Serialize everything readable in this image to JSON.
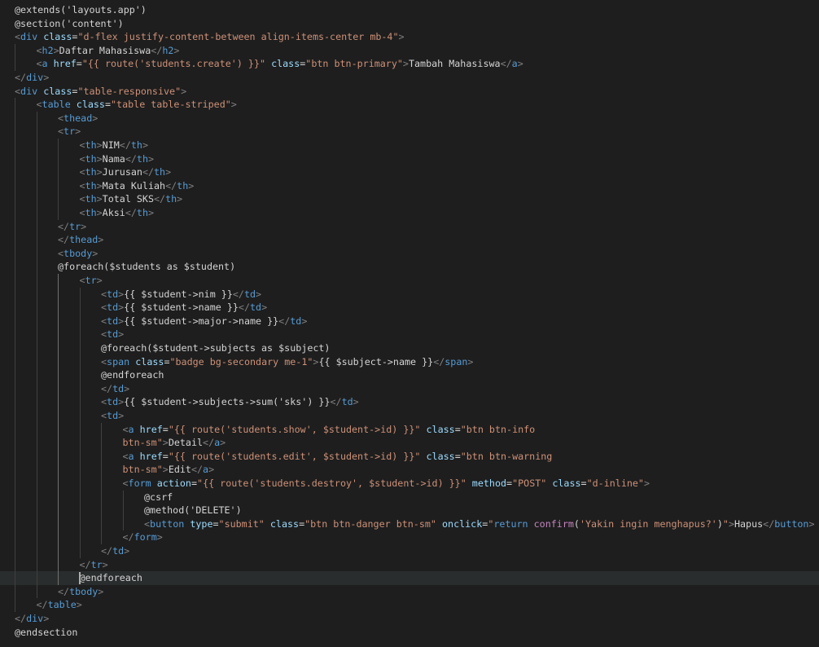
{
  "editor": {
    "language": "blade",
    "theme_colors": {
      "background": "#1e1e1e",
      "current_line": "#2a2d2e",
      "tag": "#569cd6",
      "attribute": "#9cdcfe",
      "string": "#ce9178",
      "directive": "#c586c0",
      "text": "#d4d4d4",
      "punctuation": "#808080"
    },
    "current_line_index": 42,
    "lines": [
      {
        "indent": 0,
        "segs": [
          [
            "text",
            "@extends('layouts.app')"
          ]
        ]
      },
      {
        "indent": 0,
        "segs": [
          [
            "text",
            "@section('content')"
          ]
        ]
      },
      {
        "indent": 0,
        "segs": [
          [
            "punct",
            "<"
          ],
          [
            "tag",
            "div"
          ],
          [
            "text",
            " "
          ],
          [
            "attr",
            "class"
          ],
          [
            "text",
            "="
          ],
          [
            "str",
            "\"d-flex justify-content-between align-items-center mb-4\""
          ],
          [
            "punct",
            ">"
          ]
        ]
      },
      {
        "indent": 1,
        "segs": [
          [
            "punct",
            "<"
          ],
          [
            "tag",
            "h2"
          ],
          [
            "punct",
            ">"
          ],
          [
            "text",
            "Daftar Mahasiswa"
          ],
          [
            "punct",
            "</"
          ],
          [
            "tag",
            "h2"
          ],
          [
            "punct",
            ">"
          ]
        ]
      },
      {
        "indent": 1,
        "segs": [
          [
            "punct",
            "<"
          ],
          [
            "tag",
            "a"
          ],
          [
            "text",
            " "
          ],
          [
            "attr",
            "href"
          ],
          [
            "text",
            "="
          ],
          [
            "str",
            "\"{{ route('students.create') }}\""
          ],
          [
            "text",
            " "
          ],
          [
            "attr",
            "class"
          ],
          [
            "text",
            "="
          ],
          [
            "str",
            "\"btn btn-primary\""
          ],
          [
            "punct",
            ">"
          ],
          [
            "text",
            "Tambah Mahasiswa"
          ],
          [
            "punct",
            "</"
          ],
          [
            "tag",
            "a"
          ],
          [
            "punct",
            ">"
          ]
        ]
      },
      {
        "indent": 0,
        "segs": [
          [
            "punct",
            "</"
          ],
          [
            "tag",
            "div"
          ],
          [
            "punct",
            ">"
          ]
        ]
      },
      {
        "indent": 0,
        "segs": [
          [
            "punct",
            "<"
          ],
          [
            "tag",
            "div"
          ],
          [
            "text",
            " "
          ],
          [
            "attr",
            "class"
          ],
          [
            "text",
            "="
          ],
          [
            "str",
            "\"table-responsive\""
          ],
          [
            "punct",
            ">"
          ]
        ]
      },
      {
        "indent": 1,
        "segs": [
          [
            "punct",
            "<"
          ],
          [
            "tag",
            "table"
          ],
          [
            "text",
            " "
          ],
          [
            "attr",
            "class"
          ],
          [
            "text",
            "="
          ],
          [
            "str",
            "\"table table-striped\""
          ],
          [
            "punct",
            ">"
          ]
        ]
      },
      {
        "indent": 2,
        "segs": [
          [
            "punct",
            "<"
          ],
          [
            "tag",
            "thead"
          ],
          [
            "punct",
            ">"
          ]
        ]
      },
      {
        "indent": 2,
        "segs": [
          [
            "punct",
            "<"
          ],
          [
            "tag",
            "tr"
          ],
          [
            "punct",
            ">"
          ]
        ]
      },
      {
        "indent": 3,
        "segs": [
          [
            "punct",
            "<"
          ],
          [
            "tag",
            "th"
          ],
          [
            "punct",
            ">"
          ],
          [
            "text",
            "NIM"
          ],
          [
            "punct",
            "</"
          ],
          [
            "tag",
            "th"
          ],
          [
            "punct",
            ">"
          ]
        ]
      },
      {
        "indent": 3,
        "segs": [
          [
            "punct",
            "<"
          ],
          [
            "tag",
            "th"
          ],
          [
            "punct",
            ">"
          ],
          [
            "text",
            "Nama"
          ],
          [
            "punct",
            "</"
          ],
          [
            "tag",
            "th"
          ],
          [
            "punct",
            ">"
          ]
        ]
      },
      {
        "indent": 3,
        "segs": [
          [
            "punct",
            "<"
          ],
          [
            "tag",
            "th"
          ],
          [
            "punct",
            ">"
          ],
          [
            "text",
            "Jurusan"
          ],
          [
            "punct",
            "</"
          ],
          [
            "tag",
            "th"
          ],
          [
            "punct",
            ">"
          ]
        ]
      },
      {
        "indent": 3,
        "segs": [
          [
            "punct",
            "<"
          ],
          [
            "tag",
            "th"
          ],
          [
            "punct",
            ">"
          ],
          [
            "text",
            "Mata Kuliah"
          ],
          [
            "punct",
            "</"
          ],
          [
            "tag",
            "th"
          ],
          [
            "punct",
            ">"
          ]
        ]
      },
      {
        "indent": 3,
        "segs": [
          [
            "punct",
            "<"
          ],
          [
            "tag",
            "th"
          ],
          [
            "punct",
            ">"
          ],
          [
            "text",
            "Total SKS"
          ],
          [
            "punct",
            "</"
          ],
          [
            "tag",
            "th"
          ],
          [
            "punct",
            ">"
          ]
        ]
      },
      {
        "indent": 3,
        "segs": [
          [
            "punct",
            "<"
          ],
          [
            "tag",
            "th"
          ],
          [
            "punct",
            ">"
          ],
          [
            "text",
            "Aksi"
          ],
          [
            "punct",
            "</"
          ],
          [
            "tag",
            "th"
          ],
          [
            "punct",
            ">"
          ]
        ]
      },
      {
        "indent": 2,
        "segs": [
          [
            "punct",
            "</"
          ],
          [
            "tag",
            "tr"
          ],
          [
            "punct",
            ">"
          ]
        ]
      },
      {
        "indent": 2,
        "segs": [
          [
            "punct",
            "</"
          ],
          [
            "tag",
            "thead"
          ],
          [
            "punct",
            ">"
          ]
        ]
      },
      {
        "indent": 2,
        "segs": [
          [
            "punct",
            "<"
          ],
          [
            "tag",
            "tbody"
          ],
          [
            "punct",
            ">"
          ]
        ]
      },
      {
        "indent": 2,
        "segs": [
          [
            "text",
            "@foreach($students as $student)"
          ]
        ]
      },
      {
        "indent": 3,
        "segs": [
          [
            "punct",
            "<"
          ],
          [
            "tag",
            "tr"
          ],
          [
            "punct",
            ">"
          ]
        ]
      },
      {
        "indent": 4,
        "segs": [
          [
            "punct",
            "<"
          ],
          [
            "tag",
            "td"
          ],
          [
            "punct",
            ">"
          ],
          [
            "text",
            "{{ $student->nim }}"
          ],
          [
            "punct",
            "</"
          ],
          [
            "tag",
            "td"
          ],
          [
            "punct",
            ">"
          ]
        ]
      },
      {
        "indent": 4,
        "segs": [
          [
            "punct",
            "<"
          ],
          [
            "tag",
            "td"
          ],
          [
            "punct",
            ">"
          ],
          [
            "text",
            "{{ $student->name }}"
          ],
          [
            "punct",
            "</"
          ],
          [
            "tag",
            "td"
          ],
          [
            "punct",
            ">"
          ]
        ]
      },
      {
        "indent": 4,
        "segs": [
          [
            "punct",
            "<"
          ],
          [
            "tag",
            "td"
          ],
          [
            "punct",
            ">"
          ],
          [
            "text",
            "{{ $student->major->name }}"
          ],
          [
            "punct",
            "</"
          ],
          [
            "tag",
            "td"
          ],
          [
            "punct",
            ">"
          ]
        ]
      },
      {
        "indent": 4,
        "segs": [
          [
            "punct",
            "<"
          ],
          [
            "tag",
            "td"
          ],
          [
            "punct",
            ">"
          ]
        ]
      },
      {
        "indent": 4,
        "segs": [
          [
            "text",
            "@foreach($student->subjects as $subject)"
          ]
        ]
      },
      {
        "indent": 4,
        "segs": [
          [
            "punct",
            "<"
          ],
          [
            "tag",
            "span"
          ],
          [
            "text",
            " "
          ],
          [
            "attr",
            "class"
          ],
          [
            "text",
            "="
          ],
          [
            "str",
            "\"badge bg-secondary me-1\""
          ],
          [
            "punct",
            ">"
          ],
          [
            "text",
            "{{ $subject->name }}"
          ],
          [
            "punct",
            "</"
          ],
          [
            "tag",
            "span"
          ],
          [
            "punct",
            ">"
          ]
        ]
      },
      {
        "indent": 4,
        "segs": [
          [
            "text",
            "@endforeach"
          ]
        ]
      },
      {
        "indent": 4,
        "segs": [
          [
            "punct",
            "</"
          ],
          [
            "tag",
            "td"
          ],
          [
            "punct",
            ">"
          ]
        ]
      },
      {
        "indent": 4,
        "segs": [
          [
            "punct",
            "<"
          ],
          [
            "tag",
            "td"
          ],
          [
            "punct",
            ">"
          ],
          [
            "text",
            "{{ $student->subjects->sum('sks') }}"
          ],
          [
            "punct",
            "</"
          ],
          [
            "tag",
            "td"
          ],
          [
            "punct",
            ">"
          ]
        ]
      },
      {
        "indent": 4,
        "segs": [
          [
            "punct",
            "<"
          ],
          [
            "tag",
            "td"
          ],
          [
            "punct",
            ">"
          ]
        ]
      },
      {
        "indent": 5,
        "segs": [
          [
            "punct",
            "<"
          ],
          [
            "tag",
            "a"
          ],
          [
            "text",
            " "
          ],
          [
            "attr",
            "href"
          ],
          [
            "text",
            "="
          ],
          [
            "str",
            "\"{{ route('students.show', $student->id) }}\""
          ],
          [
            "text",
            " "
          ],
          [
            "attr",
            "class"
          ],
          [
            "text",
            "="
          ],
          [
            "str",
            "\"btn btn-info"
          ]
        ]
      },
      {
        "indent": 5,
        "segs": [
          [
            "str",
            "btn-sm\""
          ],
          [
            "punct",
            ">"
          ],
          [
            "text",
            "Detail"
          ],
          [
            "punct",
            "</"
          ],
          [
            "tag",
            "a"
          ],
          [
            "punct",
            ">"
          ]
        ]
      },
      {
        "indent": 5,
        "segs": [
          [
            "punct",
            "<"
          ],
          [
            "tag",
            "a"
          ],
          [
            "text",
            " "
          ],
          [
            "attr",
            "href"
          ],
          [
            "text",
            "="
          ],
          [
            "str",
            "\"{{ route('students.edit', $student->id) }}\""
          ],
          [
            "text",
            " "
          ],
          [
            "attr",
            "class"
          ],
          [
            "text",
            "="
          ],
          [
            "str",
            "\"btn btn-warning"
          ]
        ]
      },
      {
        "indent": 5,
        "segs": [
          [
            "str",
            "btn-sm\""
          ],
          [
            "punct",
            ">"
          ],
          [
            "text",
            "Edit"
          ],
          [
            "punct",
            "</"
          ],
          [
            "tag",
            "a"
          ],
          [
            "punct",
            ">"
          ]
        ]
      },
      {
        "indent": 5,
        "segs": [
          [
            "punct",
            "<"
          ],
          [
            "tag",
            "form"
          ],
          [
            "text",
            " "
          ],
          [
            "attr",
            "action"
          ],
          [
            "text",
            "="
          ],
          [
            "str",
            "\"{{ route('students.destroy', $student->id) }}\""
          ],
          [
            "text",
            " "
          ],
          [
            "attr",
            "method"
          ],
          [
            "text",
            "="
          ],
          [
            "str",
            "\"POST\""
          ],
          [
            "text",
            " "
          ],
          [
            "attr",
            "class"
          ],
          [
            "text",
            "="
          ],
          [
            "str",
            "\"d-inline\""
          ],
          [
            "punct",
            ">"
          ]
        ]
      },
      {
        "indent": 6,
        "segs": [
          [
            "text",
            "@csrf"
          ]
        ]
      },
      {
        "indent": 6,
        "segs": [
          [
            "text",
            "@method('DELETE')"
          ]
        ]
      },
      {
        "indent": 6,
        "segs": [
          [
            "punct",
            "<"
          ],
          [
            "tag",
            "button"
          ],
          [
            "text",
            " "
          ],
          [
            "attr",
            "type"
          ],
          [
            "text",
            "="
          ],
          [
            "str",
            "\"submit\""
          ],
          [
            "text",
            " "
          ],
          [
            "attr",
            "class"
          ],
          [
            "text",
            "="
          ],
          [
            "str",
            "\"btn btn-danger btn-sm\""
          ],
          [
            "text",
            " "
          ],
          [
            "attr",
            "onclick"
          ],
          [
            "text",
            "="
          ],
          [
            "str",
            "\""
          ],
          [
            "tag",
            "return"
          ],
          [
            "text",
            " "
          ],
          [
            "dir",
            "confirm"
          ],
          [
            "text",
            "("
          ],
          [
            "str",
            "'Yakin ingin menghapus?'"
          ],
          [
            "text",
            ")"
          ],
          [
            "str",
            "\""
          ],
          [
            "punct",
            ">"
          ],
          [
            "text",
            "Hapus"
          ],
          [
            "punct",
            "</"
          ],
          [
            "tag",
            "button"
          ],
          [
            "punct",
            ">"
          ]
        ]
      },
      {
        "indent": 5,
        "segs": [
          [
            "punct",
            "</"
          ],
          [
            "tag",
            "form"
          ],
          [
            "punct",
            ">"
          ]
        ]
      },
      {
        "indent": 4,
        "segs": [
          [
            "punct",
            "</"
          ],
          [
            "tag",
            "td"
          ],
          [
            "punct",
            ">"
          ]
        ]
      },
      {
        "indent": 3,
        "segs": [
          [
            "punct",
            "</"
          ],
          [
            "tag",
            "tr"
          ],
          [
            "punct",
            ">"
          ]
        ]
      },
      {
        "indent": 3,
        "segs": [
          [
            "text",
            "@endforeach"
          ]
        ]
      },
      {
        "indent": 2,
        "segs": [
          [
            "punct",
            "</"
          ],
          [
            "tag",
            "tbody"
          ],
          [
            "punct",
            ">"
          ]
        ]
      },
      {
        "indent": 1,
        "segs": [
          [
            "punct",
            "</"
          ],
          [
            "tag",
            "table"
          ],
          [
            "punct",
            ">"
          ]
        ]
      },
      {
        "indent": 0,
        "segs": [
          [
            "punct",
            "</"
          ],
          [
            "tag",
            "div"
          ],
          [
            "punct",
            ">"
          ]
        ]
      },
      {
        "indent": 0,
        "segs": [
          [
            "text",
            "@endsection"
          ]
        ]
      }
    ]
  }
}
